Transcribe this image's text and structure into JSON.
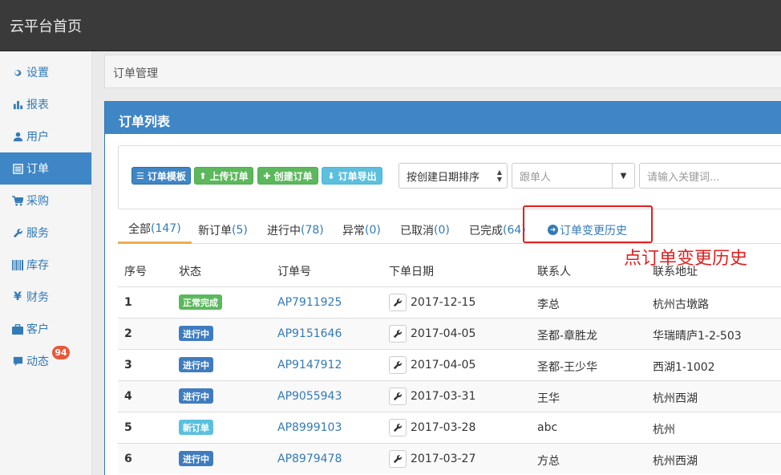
{
  "header": {
    "brand": "云平台首页"
  },
  "sidebar": {
    "items": [
      {
        "label": "设置",
        "icon": "gear-icon"
      },
      {
        "label": "报表",
        "icon": "bar-chart-icon"
      },
      {
        "label": "用户",
        "icon": "user-icon"
      },
      {
        "label": "订单",
        "icon": "list-icon",
        "active": true
      },
      {
        "label": "采购",
        "icon": "cart-icon"
      },
      {
        "label": "服务",
        "icon": "wrench-icon"
      },
      {
        "label": "库存",
        "icon": "barcode-icon"
      },
      {
        "label": "财务",
        "icon": "yen-icon"
      },
      {
        "label": "客户",
        "icon": "briefcase-icon"
      },
      {
        "label": "动态",
        "icon": "comment-icon",
        "badge": "94"
      }
    ]
  },
  "breadcrumb": {
    "text": "订单管理"
  },
  "panel": {
    "title": "订单列表"
  },
  "toolbar": {
    "template_button": "订单模板",
    "upload_button": "上传订单",
    "create_button": "创建订单",
    "export_button": "订单导出",
    "sort_select": "按创建日期排序",
    "follower_placeholder": "跟单人",
    "keyword_placeholder": "请输入关键词..."
  },
  "tabs": [
    {
      "label": "全部",
      "count": "147"
    },
    {
      "label": "新订单",
      "count": "5"
    },
    {
      "label": "进行中",
      "count": "78"
    },
    {
      "label": "异常",
      "count": "0"
    },
    {
      "label": "已取消",
      "count": "0"
    },
    {
      "label": "已完成",
      "count": "64"
    }
  ],
  "history_tab": "订单变更历史",
  "annotation": "点订单变更历史",
  "table": {
    "headers": [
      "序号",
      "状态",
      "订单号",
      "下单日期",
      "联系人",
      "联系地址"
    ],
    "rows": [
      {
        "no": "1",
        "status": "正常完成",
        "status_color": "#5cb85c",
        "order": "AP7911925",
        "date": "2017-12-15",
        "contact": "李总",
        "address": "杭州古墩路"
      },
      {
        "no": "2",
        "status": "进行中",
        "status_color": "#3f7cbf",
        "order": "AP9151646",
        "date": "2017-04-05",
        "contact": "圣都-章胜龙",
        "address": "华瑞晴庐1-2-503"
      },
      {
        "no": "3",
        "status": "进行中",
        "status_color": "#3f7cbf",
        "order": "AP9147912",
        "date": "2017-04-05",
        "contact": "圣都-王少华",
        "address": "西湖1-1002"
      },
      {
        "no": "4",
        "status": "进行中",
        "status_color": "#3f7cbf",
        "order": "AP9055943",
        "date": "2017-03-31",
        "contact": "王华",
        "address": "杭州西湖"
      },
      {
        "no": "5",
        "status": "新订单",
        "status_color": "#5bc0de",
        "order": "AP8999103",
        "date": "2017-03-28",
        "contact": "abc",
        "address": "杭州"
      },
      {
        "no": "6",
        "status": "进行中",
        "status_color": "#3f7cbf",
        "order": "AP8979478",
        "date": "2017-03-27",
        "contact": "方总",
        "address": "杭州西湖"
      }
    ]
  }
}
